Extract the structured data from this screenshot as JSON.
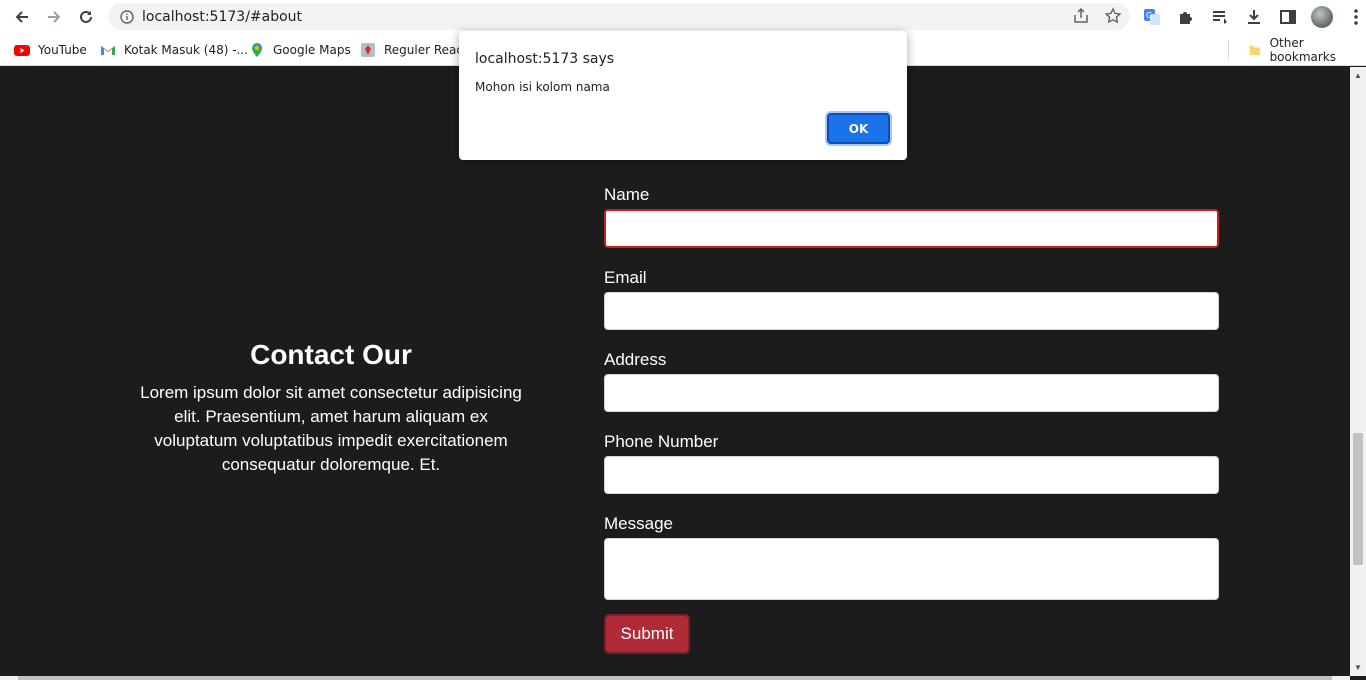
{
  "browser": {
    "url": "localhost:5173/#about",
    "bookmarks": [
      {
        "label": "YouTube",
        "icon": "youtube-icon"
      },
      {
        "label": "Kotak Masuk (48) -...",
        "icon": "gmail-icon"
      },
      {
        "label": "Google Maps",
        "icon": "maps-icon"
      },
      {
        "label": "Reguler React",
        "icon": "bookmark-favicon"
      }
    ],
    "other_bookmarks": "Other bookmarks"
  },
  "contact": {
    "heading": "Contact Our",
    "description": "Lorem ipsum dolor sit amet consectetur adipisicing elit. Praesentium, amet harum aliquam ex voluptatum voluptatibus impedit exercitationem consequatur doloremque. Et."
  },
  "form": {
    "name_label": "Name",
    "email_label": "Email",
    "address_label": "Address",
    "phone_label": "Phone Number",
    "message_label": "Message",
    "submit_label": "Submit"
  },
  "dialog": {
    "title": "localhost:5173 says",
    "message": "Mohon isi kolom nama",
    "ok_label": "OK"
  },
  "colors": {
    "page_bg": "#1c1c1c",
    "submit_bg": "#b02a37",
    "invalid_border": "#c81e1e",
    "ok_button": "#1a73e8"
  }
}
